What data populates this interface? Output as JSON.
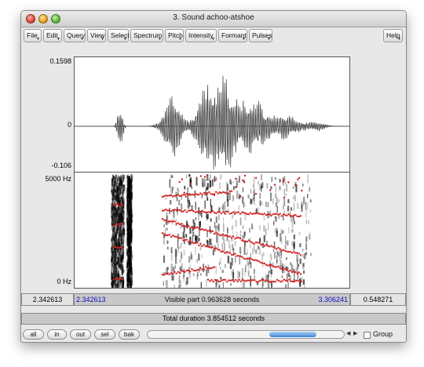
{
  "window": {
    "title": "3. Sound achoo-atshoe"
  },
  "menu": [
    {
      "label": "File",
      "name": "menu-file"
    },
    {
      "label": "Edit",
      "name": "menu-edit"
    },
    {
      "label": "Query",
      "name": "menu-query"
    },
    {
      "label": "View",
      "name": "menu-view"
    },
    {
      "label": "Select",
      "name": "menu-select"
    },
    {
      "label": "Spectrum",
      "name": "menu-spectrum"
    },
    {
      "label": "Pitch",
      "name": "menu-pitch"
    },
    {
      "label": "Intensity",
      "name": "menu-intensity"
    },
    {
      "label": "Formant",
      "name": "menu-formant"
    },
    {
      "label": "Pulses",
      "name": "menu-pulses"
    }
  ],
  "help_label": "Help",
  "waveform": {
    "ymax": "0.1598",
    "yzero": "0",
    "ymin": "-0.106"
  },
  "spectrogram": {
    "ymax": "5000 Hz",
    "ymin": "0 Hz"
  },
  "visible_bar": {
    "left_time": "2.342613",
    "start": "2.342613",
    "label": "Visible part 0.963628 seconds",
    "end": "3.306241",
    "right_time": "0.548271"
  },
  "total_bar": {
    "label": "Total duration 3.854512 seconds"
  },
  "bottom": {
    "buttons": [
      "all",
      "in",
      "out",
      "sel",
      "bak"
    ],
    "group_label": "Group"
  },
  "colors": {
    "formant": "#d42020",
    "selection_blue": "#1010c0",
    "accent": "#3a85d8"
  }
}
